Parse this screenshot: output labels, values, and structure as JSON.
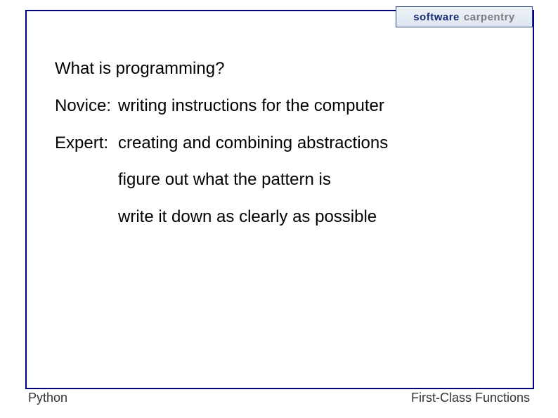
{
  "logo": {
    "word1": "software",
    "word2": "carpentry"
  },
  "slide": {
    "heading": "What is programming?",
    "novice_label": "Novice:",
    "novice_text": "writing instructions for the computer",
    "expert_label": "Expert:",
    "expert_text": "creating and combining abstractions",
    "bullet1": "figure out what the pattern is",
    "bullet2": "write it down as clearly as possible"
  },
  "footer": {
    "left": "Python",
    "right": "First-Class Functions"
  }
}
